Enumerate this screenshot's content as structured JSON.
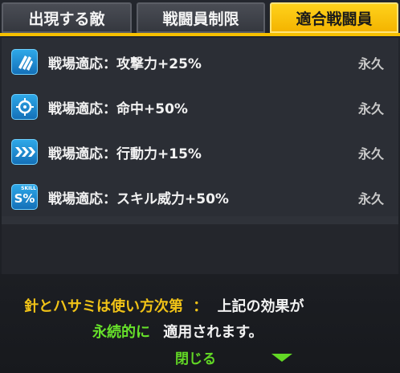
{
  "tabs": [
    {
      "label": "出現する敵",
      "active": false
    },
    {
      "label": "戦闘員制限",
      "active": false
    },
    {
      "label": "適合戦闘員",
      "active": true
    }
  ],
  "effects": [
    {
      "icon": "attack-bullets-icon",
      "label": "戦場適応：攻撃力+25%",
      "duration": "永久"
    },
    {
      "icon": "crosshair-icon",
      "label": "戦場適応：命中+50%",
      "duration": "永久"
    },
    {
      "icon": "speed-chevrons-icon",
      "label": "戦場適応：行動力+15%",
      "duration": "永久"
    },
    {
      "icon": "skill-percent-icon",
      "label": "戦場適応：スキル威力+50%",
      "duration": "永久",
      "icon_text": "S%",
      "icon_small_text": "SKILL"
    }
  ],
  "footer": {
    "source_name": "針とハサミは使い方次第",
    "separator": "：",
    "text_a": "上記の効果が",
    "permanent": "永続的に",
    "text_b": "適用されます。",
    "close_label": "閉じる"
  },
  "colors": {
    "accent_yellow": "#f6c000",
    "icon_blue": "#1e8fd6",
    "green": "#62d825",
    "text_yellow": "#f1c317"
  }
}
